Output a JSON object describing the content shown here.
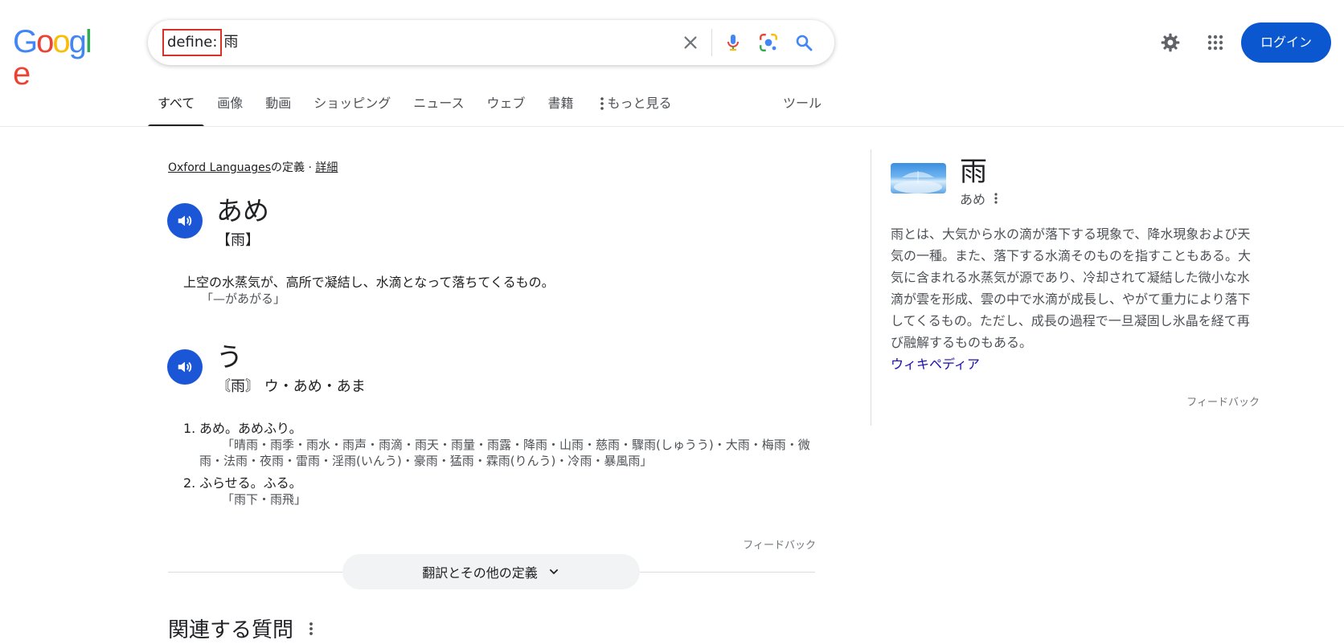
{
  "logo": {
    "letters": [
      "G",
      "o",
      "o",
      "g",
      "l",
      "e"
    ],
    "colors": [
      "#4285F4",
      "#EA4335",
      "#FBBC05",
      "#4285F4",
      "#34A853",
      "#EA4335"
    ]
  },
  "search": {
    "operator": "define:",
    "term": "雨"
  },
  "header": {
    "login_label": "ログイン"
  },
  "tabs": [
    {
      "label": "すべて"
    },
    {
      "label": "画像"
    },
    {
      "label": "動画"
    },
    {
      "label": "ショッピング"
    },
    {
      "label": "ニュース"
    },
    {
      "label": "ウェブ"
    },
    {
      "label": "書籍"
    },
    {
      "label": "もっと見る"
    }
  ],
  "tools_label": "ツール",
  "dictionary": {
    "source_link": "Oxford Languages",
    "source_suffix": "の定義 · ",
    "details_link": "詳細",
    "entries": [
      {
        "headword": "あめ",
        "kanji": "【雨】",
        "definition": "上空の水蒸気が、高所で凝結し、水滴となって落ちてくるもの。",
        "example": "「—があがる」"
      },
      {
        "headword": "う",
        "kanji": "〘雨〙 ウ・あめ・あま",
        "senses": [
          {
            "num": "1.",
            "text": "あめ。あめふり。",
            "example": "「晴雨・雨季・雨水・雨声・雨滴・雨天・雨量・雨露・降雨・山雨・慈雨・驟雨(しゅうう)・大雨・梅雨・微雨・法雨・夜雨・雷雨・淫雨(いんう)・豪雨・猛雨・霖雨(りんう)・冷雨・暴風雨」"
          },
          {
            "num": "2.",
            "text": "ふらせる。ふる。",
            "example": "「雨下・雨飛」"
          }
        ]
      }
    ],
    "feedback": "フィードバック",
    "expand_label": "翻訳とその他の定義"
  },
  "related_questions_title": "関連する質問",
  "knowledge_panel": {
    "title": "雨",
    "reading": "あめ",
    "description": "雨とは、大気から水の滴が落下する現象で、降水現象および天気の一種。また、落下する水滴そのものを指すこともある。大気に含まれる水蒸気が源であり、冷却されて凝結した微小な水滴が雲を形成、雲の中で水滴が成長し、やがて重力により落下してくるもの。ただし、成長の過程で一旦凝固し氷晶を経て再び融解するものもある。",
    "source_link": "ウィキペディア",
    "feedback": "フィードバック"
  },
  "colors": {
    "accent": "#0b57d0",
    "link": "#1a0dab",
    "query_highlight": "#d93025"
  }
}
